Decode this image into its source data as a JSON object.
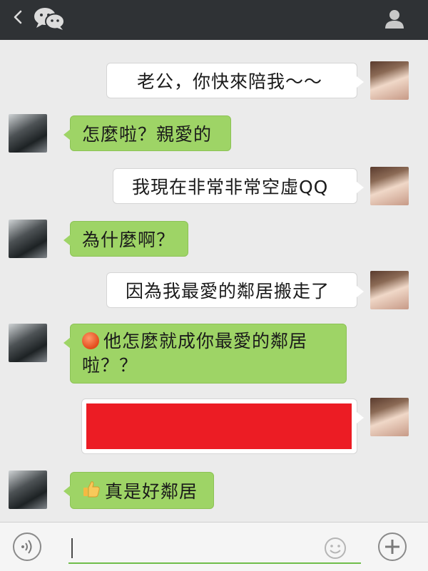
{
  "topbar": {
    "back_icon": "chevron-left-icon",
    "logo_icon": "wechat-logo-icon",
    "profile_icon": "person-icon",
    "background": "#2f3235"
  },
  "messages": [
    {
      "from": "her",
      "text": "老公，你快來陪我～～"
    },
    {
      "from": "him",
      "text": "怎麼啦？親愛的"
    },
    {
      "from": "her",
      "text": "我現在非常非常空虛QQ"
    },
    {
      "from": "him",
      "text": "為什麼啊？"
    },
    {
      "from": "her",
      "text": "因為我最愛的鄰居搬走了"
    },
    {
      "from": "him",
      "emoji": "angry-face-icon",
      "line1": "他怎麼就成你最愛的鄰居",
      "line2": "啦？？"
    },
    {
      "from": "her",
      "redacted": true,
      "redaction_color": "#ec1c24"
    },
    {
      "from": "him",
      "emoji": "thumbs-up-icon",
      "text": "真是好鄰居"
    }
  ],
  "colors": {
    "chat_background": "#ebebeb",
    "sent_bubble": "#ffffff",
    "received_bubble": "#9ed466",
    "input_underline": "#6fbe4a"
  },
  "inputbar": {
    "voice_icon": "voice-icon",
    "emoji_icon": "smiley-icon",
    "more_icon": "plus-icon"
  }
}
